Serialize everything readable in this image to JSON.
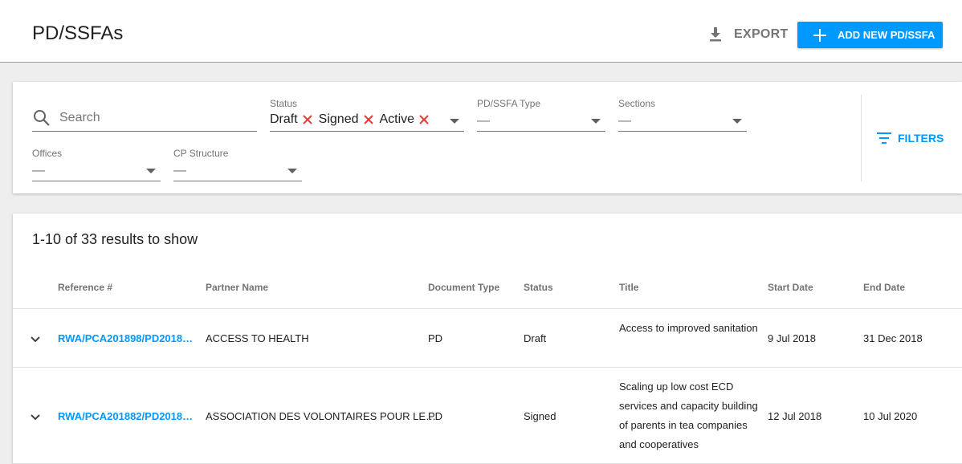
{
  "header": {
    "title": "PD/SSFAs",
    "export_label": "EXPORT",
    "add_label": "ADD NEW PD/SSFA"
  },
  "filters": {
    "search_placeholder": "Search",
    "status": {
      "label": "Status",
      "chips": [
        "Draft",
        "Signed",
        "Active"
      ]
    },
    "type": {
      "label": "PD/SSFA Type",
      "value": "—"
    },
    "sections": {
      "label": "Sections",
      "value": "—"
    },
    "offices": {
      "label": "Offices",
      "value": "—"
    },
    "cp_structure": {
      "label": "CP Structure",
      "value": "—"
    },
    "filters_button": "FILTERS"
  },
  "results": {
    "count_text": "1-10 of 33 results to show",
    "columns": [
      "Reference #",
      "Partner Name",
      "Document Type",
      "Status",
      "Title",
      "Start Date",
      "End Date"
    ],
    "rows": [
      {
        "reference": "RWA/PCA201898/PD2018…",
        "partner": "ACCESS TO HEALTH",
        "doc_type": "PD",
        "status": "Draft",
        "title": "Access to improved sanitation",
        "start": "9 Jul 2018",
        "end": "31 Dec 2018"
      },
      {
        "reference": "RWA/PCA201882/PD2018…",
        "partner": "ASSOCIATION DES VOLONTAIRES POUR LE…",
        "doc_type": "PD",
        "status": "Signed",
        "title": "Scaling up low cost ECD services and capacity building of parents in tea companies and cooperatives",
        "start": "12 Jul 2018",
        "end": "10 Jul 2020"
      }
    ]
  },
  "colors": {
    "accent": "#0099ff",
    "chip_remove": "#e53935"
  }
}
